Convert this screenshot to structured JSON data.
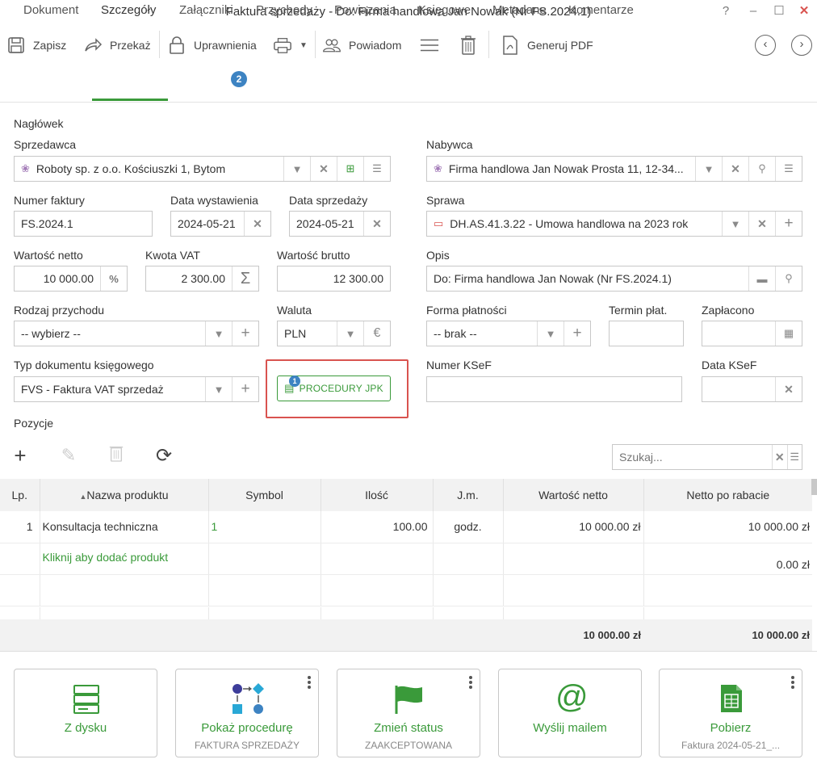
{
  "window": {
    "title": "Faktura sprzedaży - Do: Firma handlowa Jan Nowak (Nr FS.2024.1)",
    "help": "?",
    "minimize": "–",
    "maximize": "☐",
    "close": "✕"
  },
  "toolbar": {
    "save": "Zapisz",
    "forward": "Przekaż",
    "permissions": "Uprawnienia",
    "notify": "Powiadom",
    "generate_pdf": "Generuj PDF"
  },
  "tabs": [
    "Dokument",
    "Szczegóły",
    "Załączniki",
    "Przychody",
    "Powiązania",
    "Księgowe",
    "Metadane",
    "Komentarze"
  ],
  "attachments_badge": "2",
  "header_section": "Nagłówek",
  "labels": {
    "seller": "Sprzedawca",
    "buyer": "Nabywca",
    "invoice_no": "Numer faktury",
    "issue_date": "Data wystawienia",
    "sale_date": "Data sprzedaży",
    "case": "Sprawa",
    "net": "Wartość netto",
    "vat": "Kwota VAT",
    "gross": "Wartość brutto",
    "desc": "Opis",
    "income_type": "Rodzaj przychodu",
    "currency": "Waluta",
    "payment_form": "Forma płatności",
    "pay_term": "Termin płat.",
    "paid": "Zapłacono",
    "doc_type": "Typ dokumentu księgowego",
    "ksef_no": "Numer KSeF",
    "ksef_date": "Data KSeF"
  },
  "values": {
    "seller": "Roboty sp. z o.o. Kościuszki 1, Bytom",
    "buyer": "Firma handlowa Jan Nowak Prosta 11, 12-34...",
    "invoice_no": "FS.2024.1",
    "issue_date": "2024-05-21",
    "sale_date": "2024-05-21",
    "case": "DH.AS.41.3.22 - Umowa handlowa na 2023 rok",
    "net": "10 000.00",
    "vat": "2 300.00",
    "gross": "12 300.00",
    "desc": "Do: Firma handlowa Jan Nowak  (Nr FS.2024.1)",
    "income_type": "-- wybierz --",
    "currency": "PLN",
    "payment_form": "-- brak --",
    "doc_type": "FVS - Faktura VAT sprzedaż"
  },
  "jpk": {
    "label": "PROCEDURY JPK",
    "badge": "1"
  },
  "positions_section": "Pozycje",
  "search_placeholder": "Szukaj...",
  "table": {
    "headers": [
      "Lp.",
      "Nazwa produktu",
      "Symbol",
      "Ilość",
      "J.m.",
      "Wartość netto",
      "Netto po rabacie"
    ],
    "rows": [
      {
        "lp": "1",
        "name": "Konsultacja techniczna",
        "symbol": "1",
        "qty": "100.00",
        "unit": "godz.",
        "net": "10 000.00 zł",
        "net_disc": "10 000.00 zł"
      }
    ],
    "add_product": "Kliknij aby dodać produkt",
    "add_row_net_disc": "0.00 zł",
    "sum_net": "10 000.00 zł",
    "sum_net_disc": "10 000.00 zł"
  },
  "tiles": [
    {
      "label": "Z dysku",
      "sub": ""
    },
    {
      "label": "Pokaż procedurę",
      "sub": "FAKTURA SPRZEDAŻY"
    },
    {
      "label": "Zmień status",
      "sub": "ZAAKCEPTOWANA"
    },
    {
      "label": "Wyślij mailem",
      "sub": ""
    },
    {
      "label": "Pobierz",
      "sub": "Faktura 2024-05-21_..."
    }
  ],
  "colors": {
    "accent": "#3a9a3a",
    "badge": "#3d83c2",
    "highlight": "#d9534f"
  }
}
